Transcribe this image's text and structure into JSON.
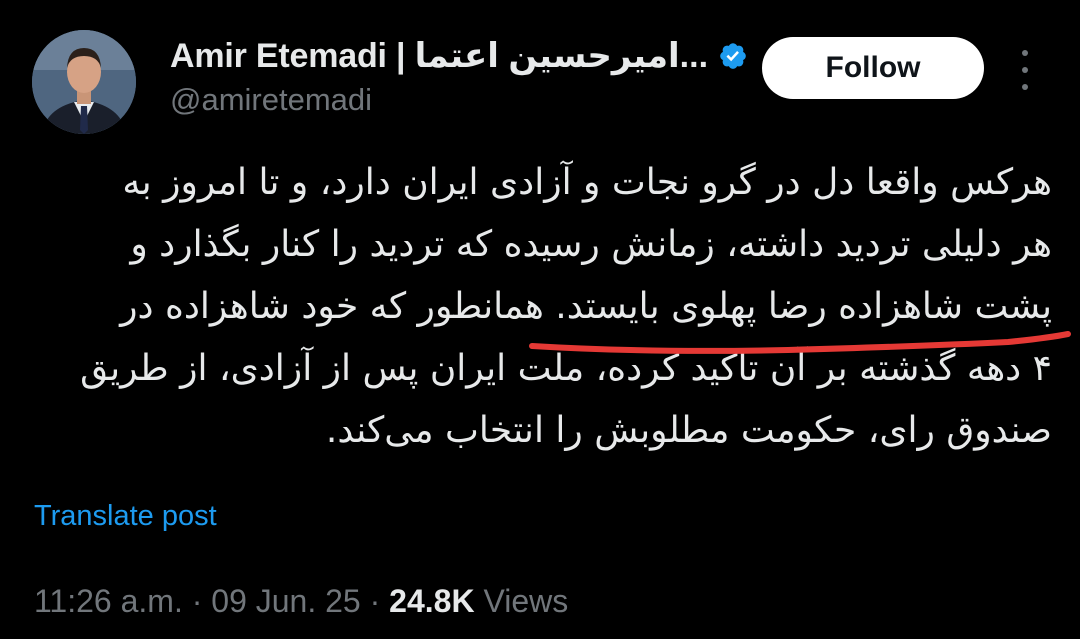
{
  "author": {
    "display_name": "Amir Etemadi | امیرحسین اعتما...",
    "handle": "@amiretemadi",
    "verified": true,
    "verified_color": "#1d9bf0"
  },
  "actions": {
    "follow_label": "Follow",
    "more_icon": "more-vertical-icon"
  },
  "post": {
    "lines": [
      "هرکس واقعا دل در گرو نجات و آزادی ایران دارد، و تا امروز به",
      "هر دلیلی تردید داشته، زمانش رسیده که تردید را کنار بگذارد و",
      "پشت شاهزاده رضا پهلوی بایستد. همانطور که خود شاهزاده در",
      "۴ دهه گذشته بر آن تاکید کرده، ملت ایران پس از آزادی، از طریق",
      "صندوق رای، حکومت مطلوبش را انتخاب می‌کند."
    ],
    "annotation_color": "#e53935",
    "translate_label": "Translate post"
  },
  "meta": {
    "time": "11:26 a.m.",
    "separator": " · ",
    "date": "09 Jun. 25",
    "views_count": "24.8K",
    "views_label": " Views"
  },
  "colors": {
    "background": "#000000",
    "text_primary": "#e7e9ea",
    "text_secondary": "#71767b",
    "link": "#1d9bf0"
  }
}
